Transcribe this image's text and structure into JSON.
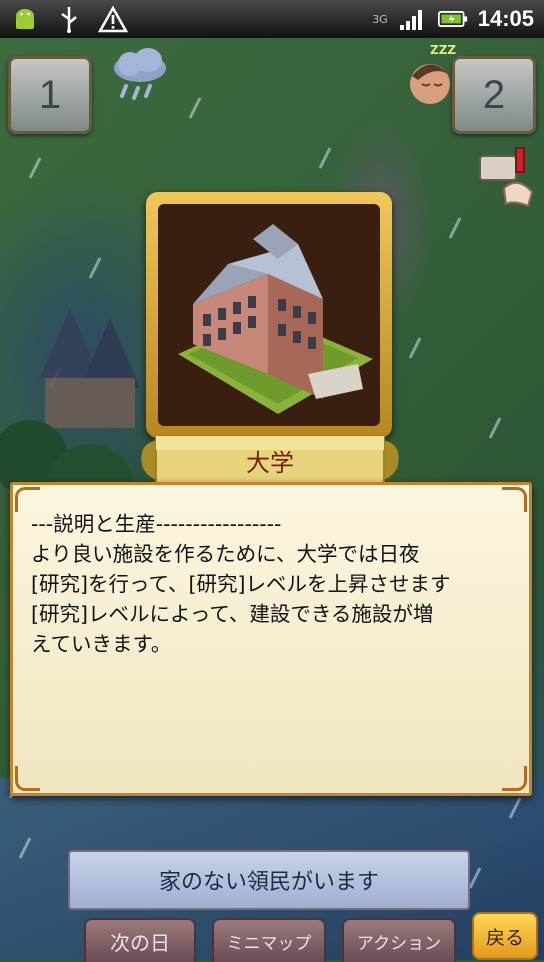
{
  "statusbar": {
    "icons": [
      "android-icon",
      "usb-icon",
      "warning-icon"
    ],
    "network_type": "3G",
    "time": "14:05"
  },
  "map": {
    "day_left": "1",
    "day_right": "2",
    "sleep_text": "ZZZ"
  },
  "building": {
    "name": "大学"
  },
  "description": {
    "text": "---説明と生産-----------------\nより良い施設を作るために、大学では日夜\n[研究]を行って、[研究]レベルを上昇させます\n[研究]レベルによって、建設できる施設が増\nえていきます。"
  },
  "message": {
    "text": "家のない領民がいます"
  },
  "buttons": {
    "next_day": "次の日",
    "minimap": "ミニマップ",
    "action": "アクション",
    "back": "戻る"
  },
  "colors": {
    "frame_gold": "#e8b53a",
    "panel_bg": "#f7f0d2",
    "name_red": "#7a1d10",
    "back_orange": "#f2b532"
  }
}
